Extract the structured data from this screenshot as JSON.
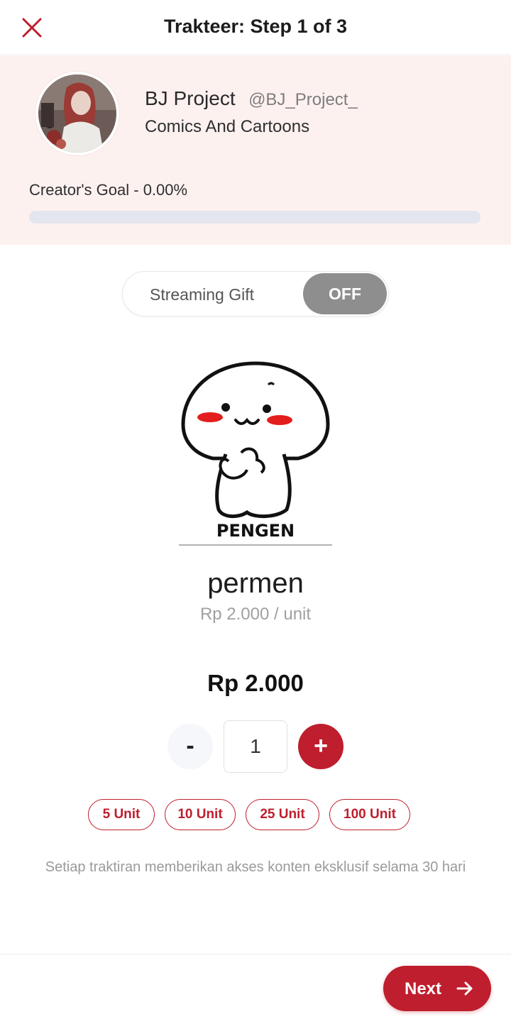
{
  "header": {
    "title": "Trakteer: Step 1 of 3",
    "close_icon": "close-icon"
  },
  "creator": {
    "name": "BJ Project",
    "handle": "@BJ_Project_",
    "category": "Comics And Cartoons",
    "goal_label": "Creator's Goal - 0.00%",
    "goal_progress": 0.0
  },
  "streaming_gift": {
    "label": "Streaming Gift",
    "state": "OFF"
  },
  "item": {
    "sticker_text": "PENGEN",
    "name": "permen",
    "unit_price": "Rp 2.000 / unit",
    "total": "Rp 2.000"
  },
  "quantity": {
    "minus_label": "-",
    "value": "1",
    "plus_label": "+"
  },
  "unit_presets": [
    "5 Unit",
    "10 Unit",
    "25 Unit",
    "100 Unit"
  ],
  "note": "Setiap traktiran memberikan akses konten eksklusif selama 30 hari",
  "footer": {
    "next_label": "Next",
    "next_icon": "arrow-right-icon"
  },
  "colors": {
    "accent": "#be1e2d",
    "creator_bg": "#fdf1f0",
    "toggle_off": "#8e8e8e"
  }
}
